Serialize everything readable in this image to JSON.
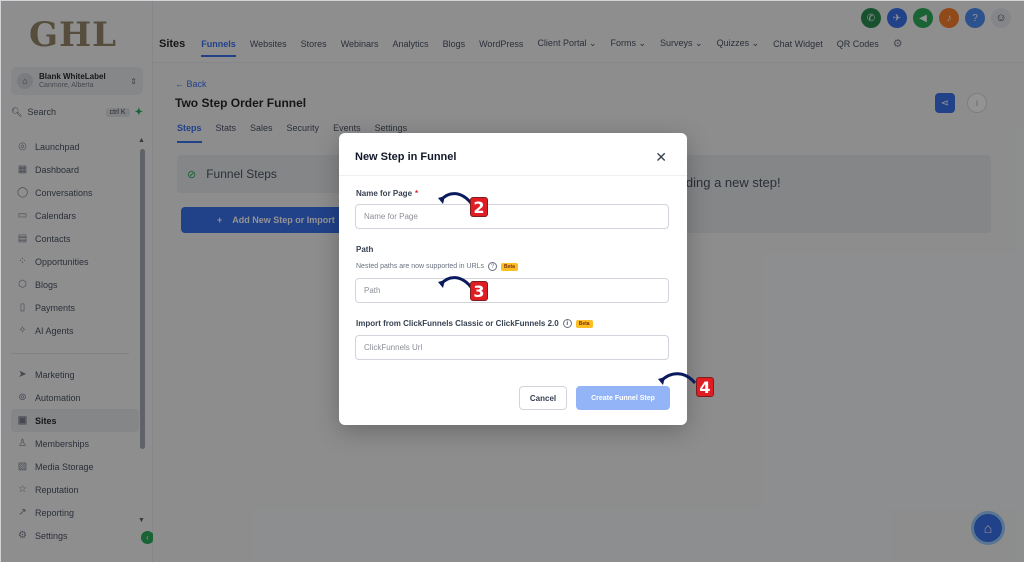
{
  "sidebar": {
    "logo": "GHL",
    "account": {
      "name": "Blank WhiteLabel",
      "location": "Canmore, Alberta"
    },
    "search": {
      "label": "Search",
      "shortcut": "ctrl K"
    },
    "items_top": [
      {
        "label": "Launchpad",
        "icon": "launchpad-icon"
      },
      {
        "label": "Dashboard",
        "icon": "dashboard-icon"
      },
      {
        "label": "Conversations",
        "icon": "conversations-icon"
      },
      {
        "label": "Calendars",
        "icon": "calendar-icon"
      },
      {
        "label": "Contacts",
        "icon": "contacts-icon"
      },
      {
        "label": "Opportunities",
        "icon": "opportunities-icon"
      },
      {
        "label": "Blogs",
        "icon": "blogs-icon"
      },
      {
        "label": "Payments",
        "icon": "payments-icon"
      },
      {
        "label": "AI Agents",
        "icon": "ai-agents-icon"
      }
    ],
    "items_bottom": [
      {
        "label": "Marketing",
        "icon": "marketing-icon"
      },
      {
        "label": "Automation",
        "icon": "automation-icon"
      },
      {
        "label": "Sites",
        "icon": "sites-icon",
        "active": true
      },
      {
        "label": "Memberships",
        "icon": "memberships-icon"
      },
      {
        "label": "Media Storage",
        "icon": "media-storage-icon"
      },
      {
        "label": "Reputation",
        "icon": "reputation-icon"
      },
      {
        "label": "Reporting",
        "icon": "reporting-icon"
      },
      {
        "label": "Settings",
        "icon": "settings-icon"
      }
    ]
  },
  "topnav": {
    "section": "Sites",
    "tabs": [
      "Funnels",
      "Websites",
      "Stores",
      "Webinars",
      "Analytics",
      "Blogs",
      "WordPress",
      "Client Portal ⌄",
      "Forms ⌄",
      "Surveys ⌄",
      "Quizzes ⌄",
      "Chat Widget",
      "QR Codes"
    ],
    "active_tab": "Funnels"
  },
  "main": {
    "back_label": "← Back",
    "title": "Two Step Order Funnel",
    "subtabs": [
      "Steps",
      "Stats",
      "Sales",
      "Security",
      "Events",
      "Settings"
    ],
    "active_subtab": "Steps",
    "steps_card_label": "Funnel Steps",
    "add_step_label": "Add New Step or Import",
    "empty_hint": "lding a new step!"
  },
  "modal": {
    "title": "New Step in Funnel",
    "name_label": "Name for Page",
    "name_required": "*",
    "name_placeholder": "Name for Page",
    "path_label": "Path",
    "path_help": "Nested paths are now supported in URLs",
    "path_placeholder": "Path",
    "beta": "Beta",
    "import_label": "Import from ClickFunnels Classic or ClickFunnels 2.0",
    "import_placeholder": "ClickFunnels Url",
    "cancel_label": "Cancel",
    "create_label": "Create Funnel Step"
  },
  "annotations": [
    "2",
    "3",
    "4"
  ],
  "colors": {
    "accent": "#2563eb",
    "annotation": "#e11d24",
    "create_disabled": "#93b4f7"
  }
}
